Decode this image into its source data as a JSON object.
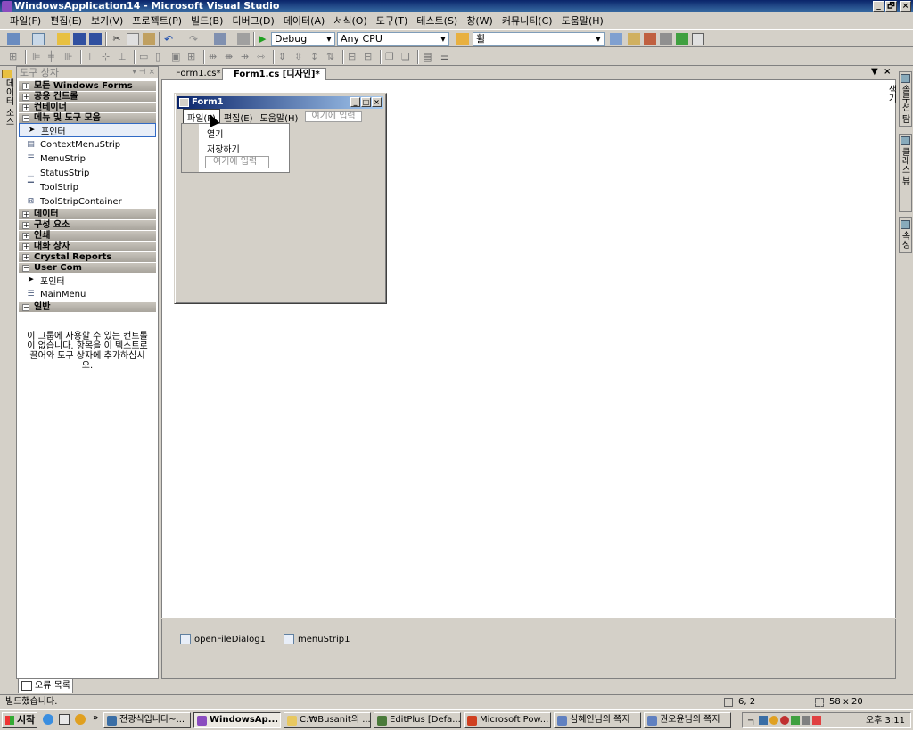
{
  "window": {
    "title": "WindowsApplication14 - Microsoft Visual Studio",
    "controls": [
      "_",
      "🗗",
      "×"
    ]
  },
  "menubar": [
    "파일(F)",
    "편집(E)",
    "보기(V)",
    "프로젝트(P)",
    "빌드(B)",
    "디버그(D)",
    "데이터(A)",
    "서식(O)",
    "도구(T)",
    "테스트(S)",
    "창(W)",
    "커뮤니티(C)",
    "도움말(H)"
  ],
  "toolbar": {
    "config": "Debug",
    "platform": "Any CPU",
    "find": "휠"
  },
  "left_tab": {
    "label": "데이터 소스"
  },
  "toolbox": {
    "header": "도구 상자",
    "header_controls": "▾ ⊣ ×",
    "sections": [
      {
        "name": "모든 Windows Forms",
        "expanded": false,
        "items": []
      },
      {
        "name": "공용 컨트롤",
        "expanded": false,
        "items": []
      },
      {
        "name": "컨테이너",
        "expanded": false,
        "items": []
      },
      {
        "name": "메뉴 및 도구 모음",
        "expanded": true,
        "items": [
          {
            "label": "포인터",
            "icon": "pointer-icon",
            "selected": true
          },
          {
            "label": "ContextMenuStrip",
            "icon": "context-menu-icon"
          },
          {
            "label": "MenuStrip",
            "icon": "menu-strip-icon"
          },
          {
            "label": "StatusStrip",
            "icon": "status-strip-icon"
          },
          {
            "label": "ToolStrip",
            "icon": "tool-strip-icon"
          },
          {
            "label": "ToolStripContainer",
            "icon": "tool-strip-container-icon"
          }
        ]
      },
      {
        "name": "데이터",
        "expanded": false,
        "items": []
      },
      {
        "name": "구성 요소",
        "expanded": false,
        "items": []
      },
      {
        "name": "인쇄",
        "expanded": false,
        "items": []
      },
      {
        "name": "대화 상자",
        "expanded": false,
        "items": []
      },
      {
        "name": "Crystal Reports",
        "expanded": false,
        "items": []
      },
      {
        "name": "User Com",
        "expanded": true,
        "items": [
          {
            "label": "포인터",
            "icon": "pointer-icon"
          },
          {
            "label": "MainMenu",
            "icon": "main-menu-icon"
          }
        ]
      },
      {
        "name": "일반",
        "expanded": true,
        "items": []
      }
    ],
    "empty_message": "이 그룹에 사용할 수 있는 컨트롤이 없습니다. 항목을 이 텍스트로 끌어와 도구 상자에 추가하십시오."
  },
  "error_tab": "오류 목록",
  "doc_tabs": [
    {
      "label": "Form1.cs*",
      "active": false
    },
    {
      "label": "Form1.cs [디자인]*",
      "active": true
    }
  ],
  "form": {
    "title": "Form1",
    "menu": [
      "파일(F)",
      "편집(E)",
      "도움말(H)"
    ],
    "type_here": "여기에 입력",
    "dropdown": [
      "열기",
      "저장하기"
    ]
  },
  "component_tray": [
    "openFileDialog1",
    "menuStrip1"
  ],
  "right_tabs": [
    "솔루션 탐색기",
    "클래스 뷰",
    "속성"
  ],
  "status": {
    "text": "빌드했습니다.",
    "position": "6, 2",
    "size": "58 x 20"
  },
  "taskbar": {
    "start": "시작",
    "buttons": [
      {
        "label": "전광식입니다~...",
        "active": false,
        "color": "#3a6ea5"
      },
      {
        "label": "WindowsAp...",
        "active": true,
        "color": "#8a4cbf"
      },
      {
        "label": "C:₩Busanit의 ...",
        "active": false,
        "color": "#e8c860"
      },
      {
        "label": "EditPlus [Defa...",
        "active": false,
        "color": "#4a7a3a"
      },
      {
        "label": "Microsoft Pow...",
        "active": false,
        "color": "#d04020"
      },
      {
        "label": "심혜인님의 쪽지",
        "active": false,
        "color": "#6080c0"
      },
      {
        "label": "권오윤님의 쪽지",
        "active": false,
        "color": "#6080c0"
      }
    ],
    "clock": "오후 3:11"
  }
}
